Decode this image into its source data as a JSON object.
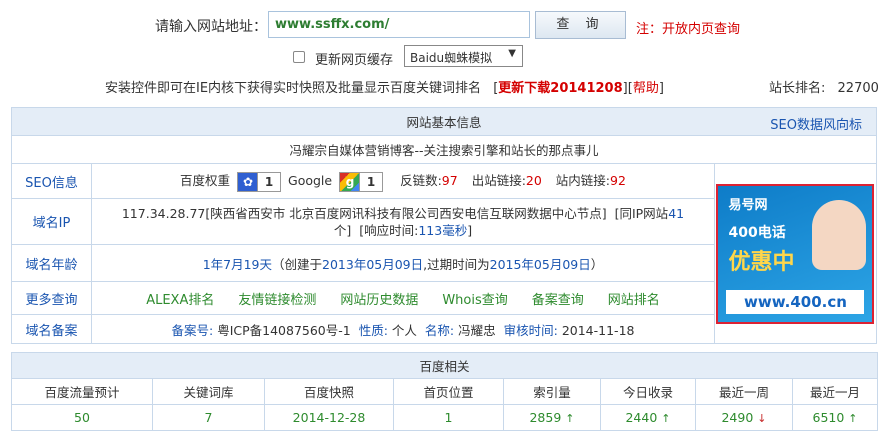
{
  "query": {
    "label": "请输入网站地址：",
    "value": "www.ssffx.com/",
    "button": "查 询",
    "note": "注：开放内页查询",
    "update_cache_label": "更新网页缓存",
    "spider_select": "Baidu蜘蛛模拟"
  },
  "info": {
    "text": "安装控件即可在IE内核下获得实时快照及批量显示百度关键词排名",
    "bracket_open": "[",
    "download_link": "更新下载20141208",
    "sep": "][",
    "help_link": "帮助",
    "bracket_close": "]",
    "rank_label": "站长排名:",
    "rank_value": "22700"
  },
  "basic": {
    "header": "网站基本信息",
    "seo_link": "SEO数据风向标",
    "site_title": "冯耀宗自媒体营销博客--关注搜索引擎和站长的那点事儿",
    "seo_label": "SEO信息",
    "baidu_weight_label": "百度权重",
    "baidu_weight": "1",
    "google_label": "Google",
    "google_pr": "1",
    "backlinks_label": "反链数:",
    "backlinks": "97",
    "outlinks_label": "出站链接:",
    "outlinks": "20",
    "inlinks_label": "站内链接:",
    "inlinks": "92",
    "ip_label": "域名IP",
    "ip_text": "117.34.28.77[陕西省西安市 北京百度网讯科技有限公司西安电信互联网数据中心节点]",
    "same_ip_label": "[同IP网站",
    "same_ip_count": "41",
    "same_ip_unit": "个]",
    "response_label": "[响应时间:",
    "response_time": "113毫秒",
    "response_close": "]",
    "age_label": "域名年龄",
    "age_value": "1年7月19天",
    "age_created_prefix": "（创建于",
    "age_created": "2013年05月09日",
    "age_expire_prefix": ",过期时间为",
    "age_expire": "2015年05月09日",
    "age_close": "）",
    "more_label": "更多查询",
    "more_links": [
      "ALEXA排名",
      "友情链接检测",
      "网站历史数据",
      "Whois查询",
      "备案查询",
      "网站排名"
    ],
    "icp_label": "域名备案",
    "icp_no_label": "备案号:",
    "icp_no": "粤ICP备14087560号-1",
    "nature_label": "性质:",
    "nature": "个人",
    "name_label": "名称:",
    "name": "冯耀忠",
    "audit_label": "审核时间:",
    "audit": "2014-11-18"
  },
  "ad": {
    "brand": "易号网",
    "tel": "400电话",
    "promo": "优惠中",
    "url": "www.400.cn"
  },
  "baidu": {
    "header": "百度相关",
    "columns": [
      "百度流量预计",
      "关键词库",
      "百度快照",
      "首页位置",
      "索引量",
      "今日收录",
      "最近一周",
      "最近一月"
    ],
    "values": [
      "50",
      "7",
      "2014-12-28",
      "1",
      "2859",
      "2440",
      "2490",
      "6510"
    ],
    "up_arrow": "↑",
    "down_arrow": "↓"
  },
  "colors": {
    "accent_blue": "#1a55b0",
    "red": "#d40000",
    "green": "#2e8b2e",
    "header_bg": "#e4edf7"
  }
}
